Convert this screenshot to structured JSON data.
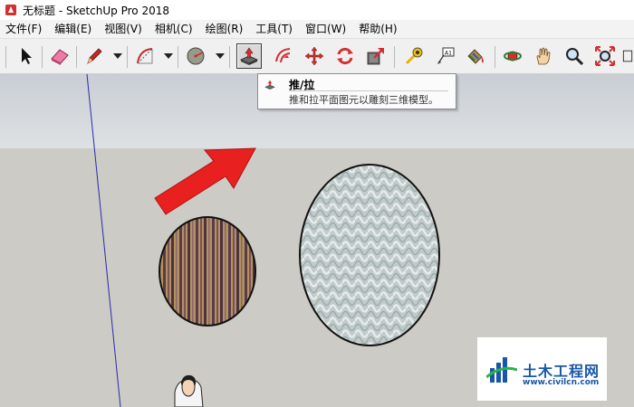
{
  "window": {
    "title": "无标题 - SketchUp Pro 2018"
  },
  "menu": [
    "文件(F)",
    "编辑(E)",
    "视图(V)",
    "相机(C)",
    "绘图(R)",
    "工具(T)",
    "窗口(W)",
    "帮助(H)"
  ],
  "tooltip": {
    "title": "推/拉",
    "description": "推和拉平面图元以雕刻三维模型。"
  },
  "watermark": {
    "name": "土木工程网",
    "url": "www.civilcn.com"
  },
  "colors": {
    "arrow": "#e82020",
    "axis_blue": "#2a2aa8",
    "sky": "#d3d7dc",
    "ground": "#cccbc6",
    "watermark_blue": "#1a56a8"
  }
}
